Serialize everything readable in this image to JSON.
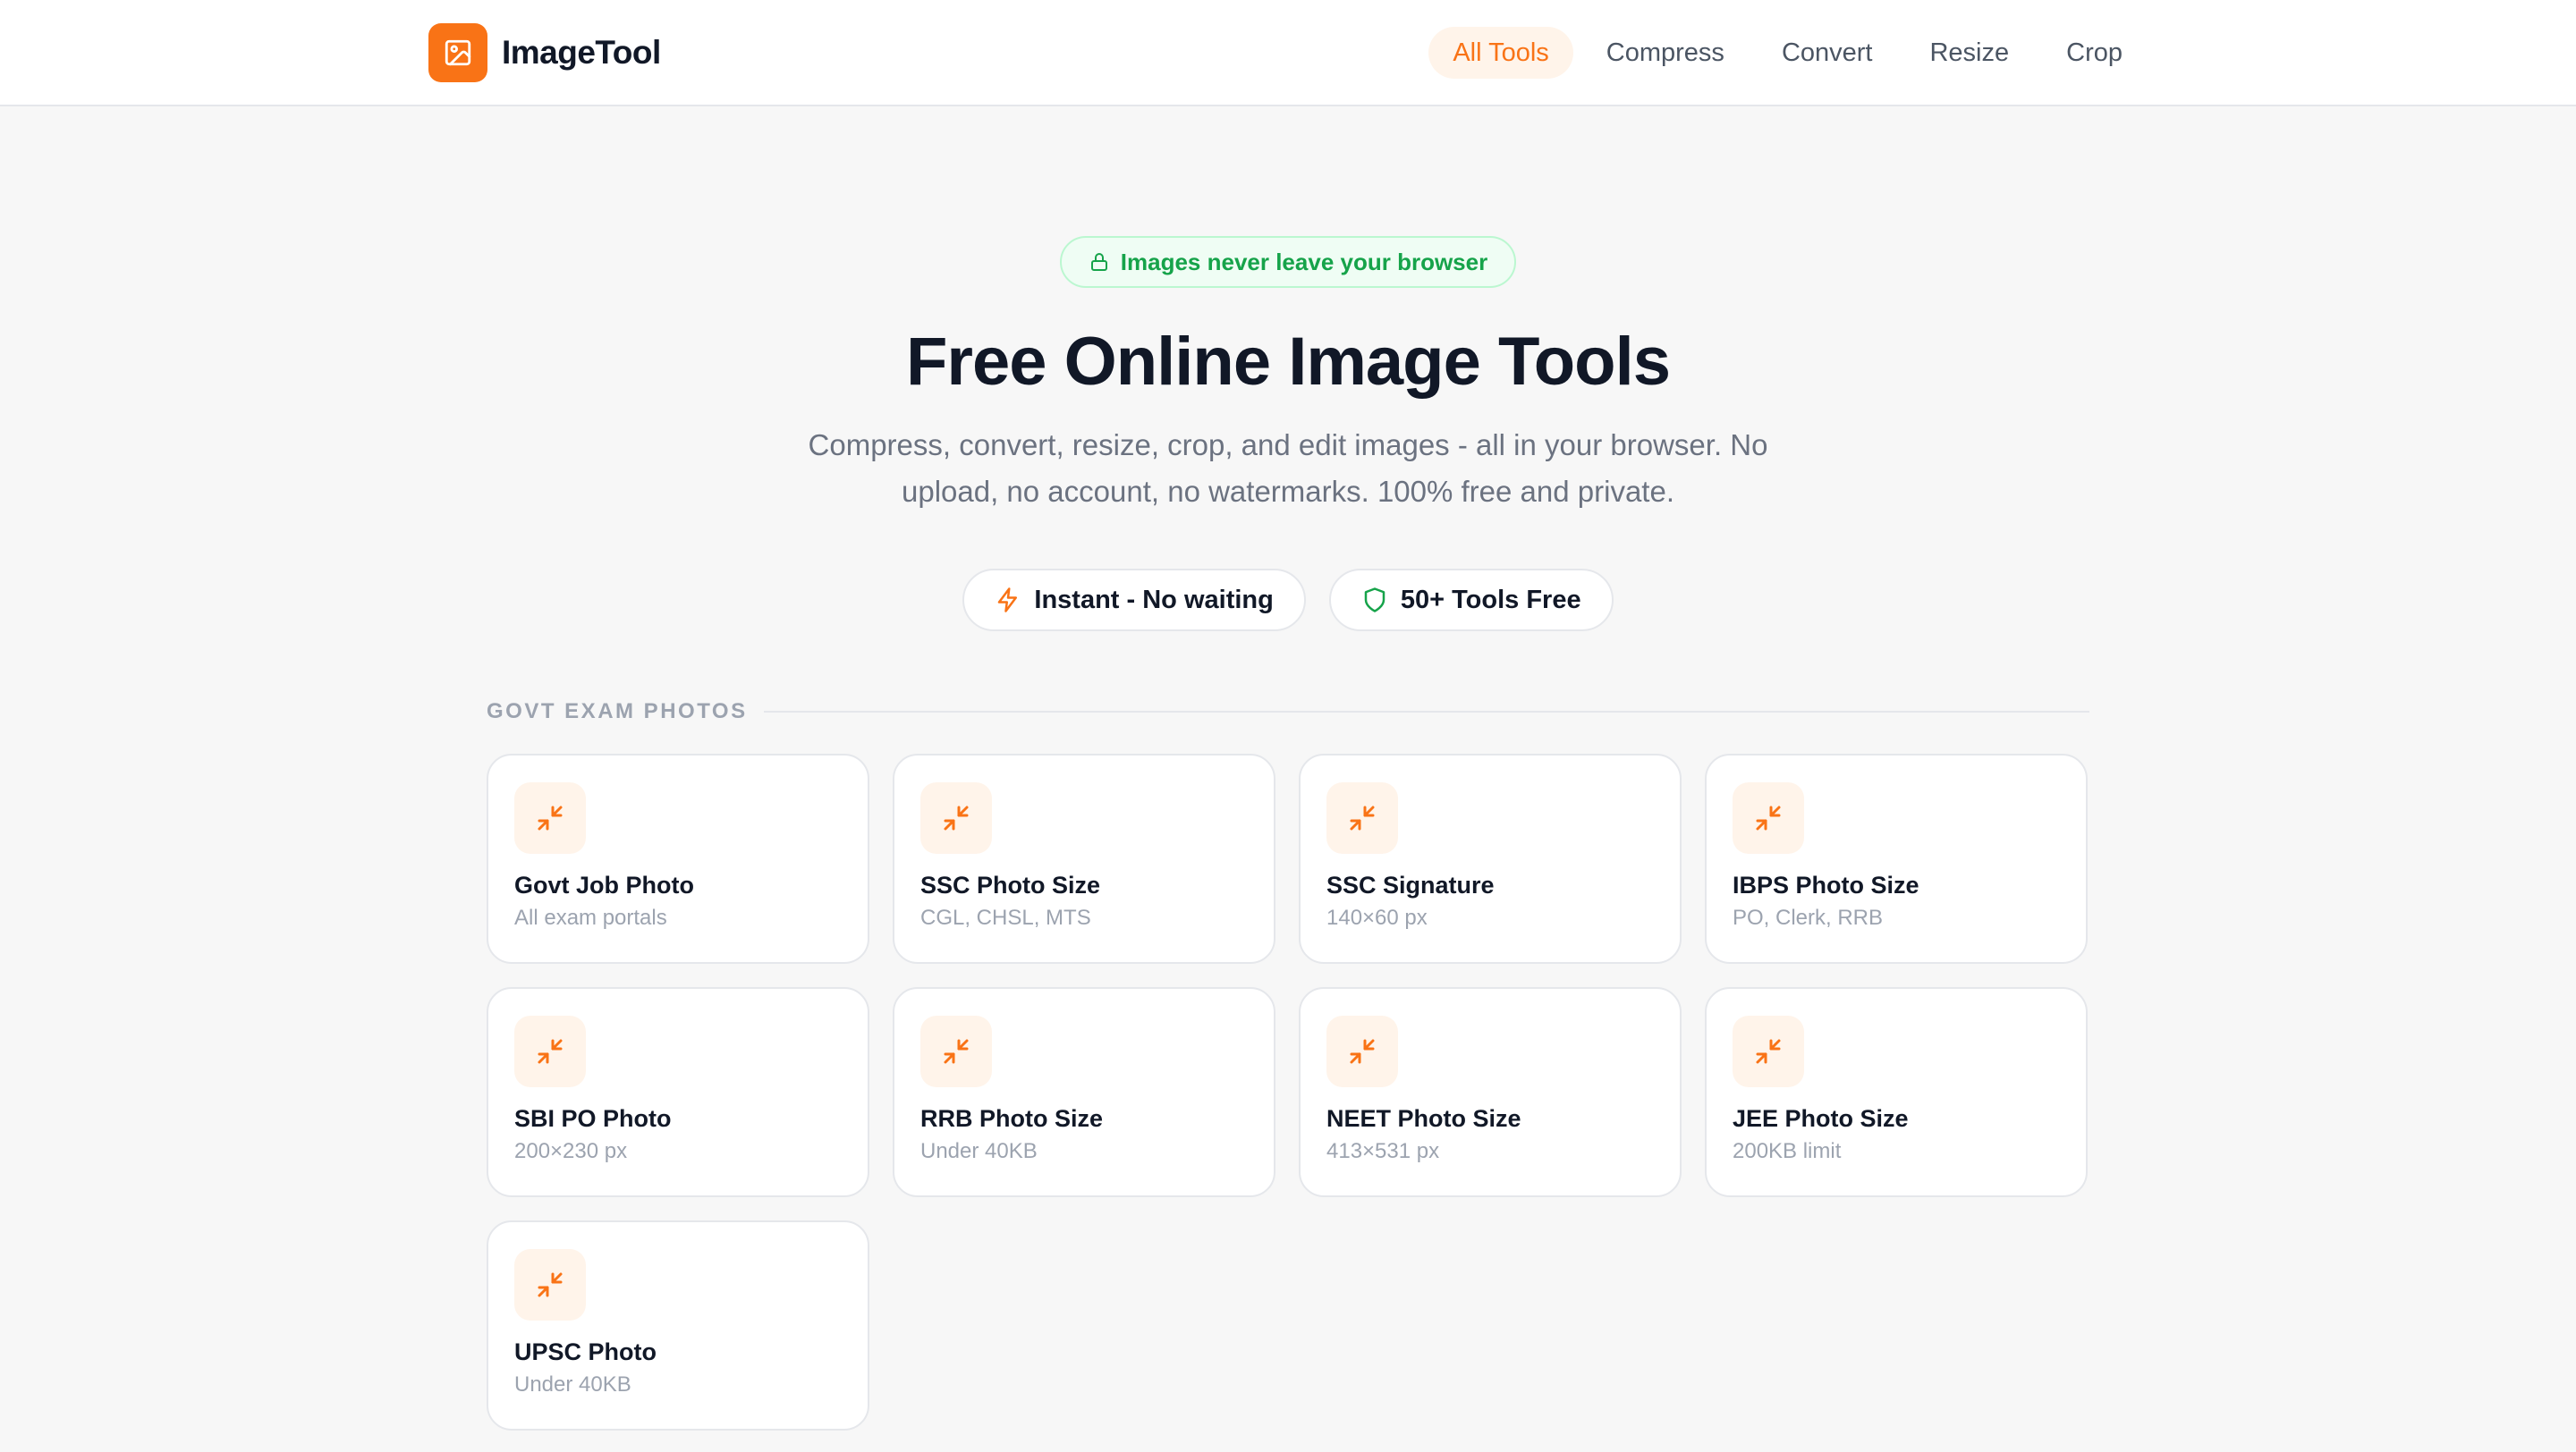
{
  "brand": {
    "name": "ImageTool",
    "logo_icon": "image-icon",
    "accent": "#f97316"
  },
  "nav": {
    "items": [
      {
        "label": "All Tools",
        "active": true
      },
      {
        "label": "Compress",
        "active": false
      },
      {
        "label": "Convert",
        "active": false
      },
      {
        "label": "Resize",
        "active": false
      },
      {
        "label": "Crop",
        "active": false
      }
    ]
  },
  "hero": {
    "badge": {
      "label": "Images never leave your browser",
      "icon": "lock-icon",
      "color": "#16a34a"
    },
    "title": "Free Online Image Tools",
    "subtitle": "Compress, convert, resize, crop, and edit images - all in your browser. No upload, no account, no watermarks. 100% free and private.",
    "pills": [
      {
        "label": "Instant - No waiting",
        "icon": "lightning-icon"
      },
      {
        "label": "50+ Tools Free",
        "icon": "shield-icon"
      }
    ]
  },
  "section": {
    "title": "GOVT EXAM PHOTOS",
    "cards": [
      {
        "title": "Govt Job Photo",
        "subtitle": "All exam portals",
        "icon": "compress-icon"
      },
      {
        "title": "SSC Photo Size",
        "subtitle": "CGL, CHSL, MTS",
        "icon": "compress-icon"
      },
      {
        "title": "SSC Signature",
        "subtitle": "140×60 px",
        "icon": "compress-icon"
      },
      {
        "title": "IBPS Photo Size",
        "subtitle": "PO, Clerk, RRB",
        "icon": "compress-icon"
      },
      {
        "title": "SBI PO Photo",
        "subtitle": "200×230 px",
        "icon": "compress-icon"
      },
      {
        "title": "RRB Photo Size",
        "subtitle": "Under 40KB",
        "icon": "compress-icon"
      },
      {
        "title": "NEET Photo Size",
        "subtitle": "413×531 px",
        "icon": "compress-icon"
      },
      {
        "title": "JEE Photo Size",
        "subtitle": "200KB limit",
        "icon": "compress-icon"
      },
      {
        "title": "UPSC Photo",
        "subtitle": "Under 40KB",
        "icon": "compress-icon"
      }
    ]
  }
}
